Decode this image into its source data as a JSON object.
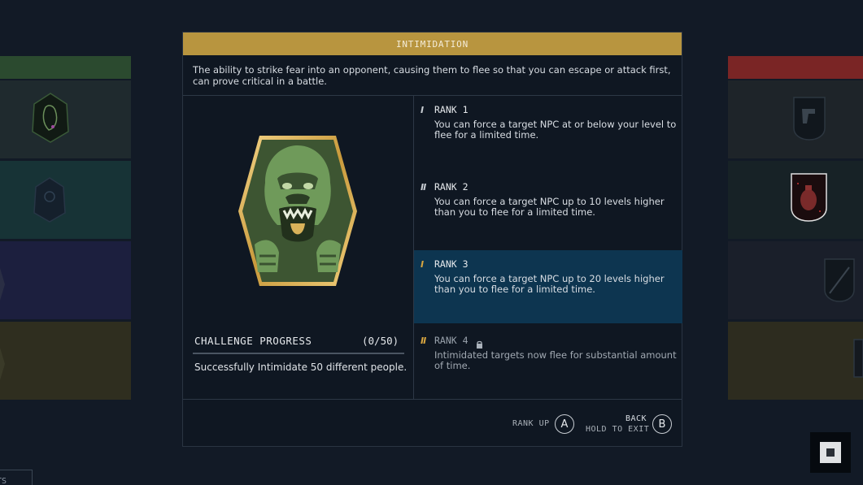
{
  "skill": {
    "title": "INTIMIDATION",
    "description": "The ability to strike fear into an opponent, causing them to flee so that you can escape or attack first, can prove critical in a battle."
  },
  "challenge": {
    "title": "CHALLENGE PROGRESS",
    "count": "(0/50)",
    "progress": 0,
    "description": "Successfully Intimidate 50 different people."
  },
  "ranks": [
    {
      "icon": "I",
      "label": "RANK 1",
      "text": "You can force a target NPC at or below your level to flee for a limited time.",
      "state": "unlocked"
    },
    {
      "icon": "II",
      "label": "RANK 2",
      "text": "You can force a target NPC up to 10 levels higher than you to flee for a limited time.",
      "state": "unlocked"
    },
    {
      "icon": "I",
      "label": "RANK 3",
      "text": "You can force a target NPC up to 20 levels higher than you to flee for a limited time.",
      "state": "selected"
    },
    {
      "icon": "II",
      "label": "RANK 4",
      "text": "Intimidated targets now flee for substantial amount of time.",
      "state": "locked"
    }
  ],
  "footer": {
    "rank_up_label": "RANK UP",
    "rank_up_button": "A",
    "back_label": "BACK",
    "hold_label": "HOLD TO EXIT",
    "back_button": "B"
  },
  "bottom_tab": "TS",
  "colors": {
    "header": "#b8953f",
    "selected_rank": "#0d3550",
    "gold_accent": "#d9a640",
    "badge_green": "#5d8a4e"
  },
  "icons": {
    "main_badge": "gorilla-icon",
    "lock": "lock-icon"
  }
}
